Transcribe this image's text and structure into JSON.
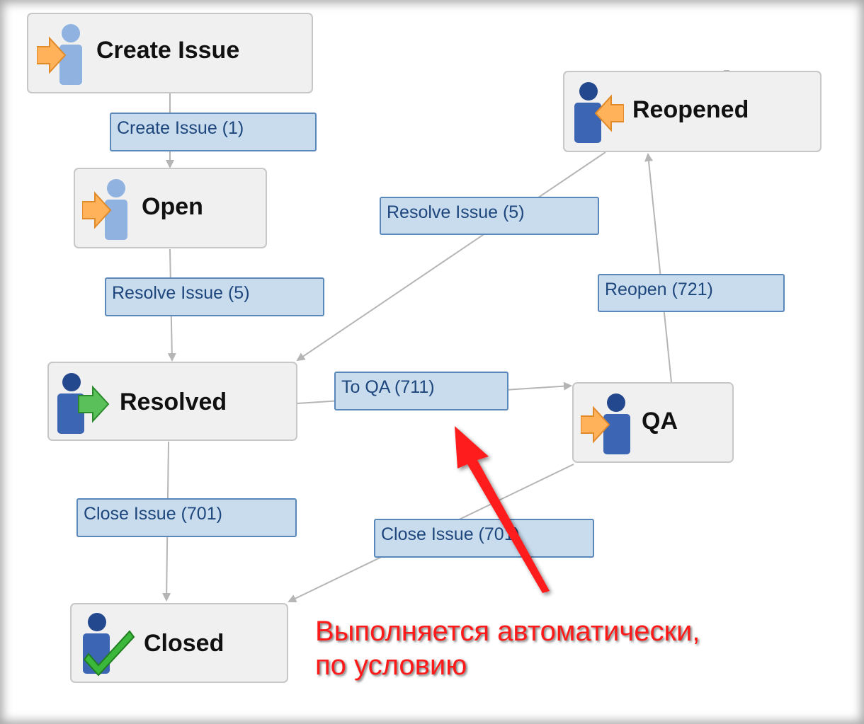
{
  "statuses": {
    "create_issue": "Create Issue",
    "open": "Open",
    "reopened": "Reopened",
    "resolved": "Resolved",
    "qa": "QA",
    "closed": "Closed"
  },
  "transitions": {
    "create_issue": "Create Issue (1)",
    "resolve_from_reopened": "Resolve Issue (5)",
    "resolve_from_open": "Resolve Issue (5)",
    "reopen": "Reopen (721)",
    "to_qa": "To QA (711)",
    "close_from_resolved": "Close Issue (701)",
    "close_from_qa": "Close Issue (701)"
  },
  "annotation": {
    "line1": "Выполняется автоматически,",
    "line2": "по условию",
    "color": "#ff1a1a"
  },
  "colors": {
    "node_bg": "#f0f0f0",
    "label_bg": "#c9dcee",
    "label_border": "#5a88ba",
    "label_text": "#1d467c",
    "edge": "#b5b5b5"
  },
  "icons": {
    "create_issue": "person-arrow-in-icon",
    "open": "person-arrow-in-icon",
    "reopened": "person-arrow-back-icon",
    "resolved": "person-arrow-out-icon",
    "qa": "person-arrow-in-icon",
    "closed": "person-check-icon"
  }
}
